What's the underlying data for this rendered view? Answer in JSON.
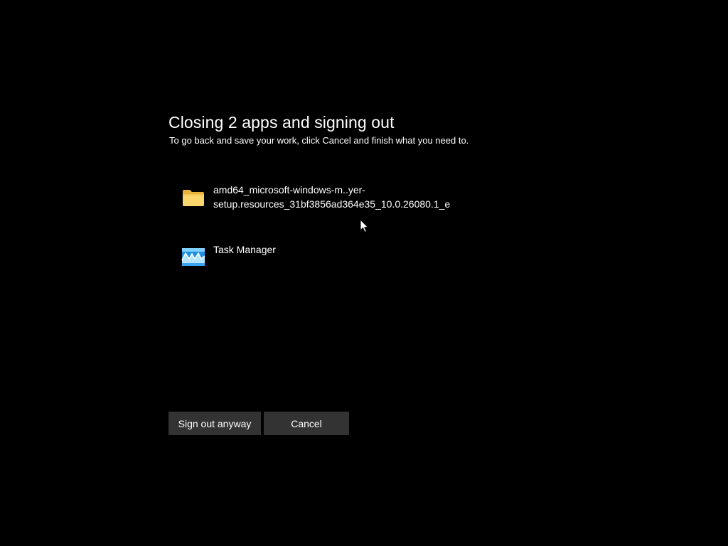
{
  "dialog": {
    "title": "Closing 2 apps and signing out",
    "subtitle": "To go back and save your work, click Cancel and finish what you need to."
  },
  "apps": [
    {
      "icon": "folder-icon",
      "name_line1": "amd64_microsoft-windows-m..yer-",
      "name_line2": "setup.resources_31bf3856ad364e35_10.0.26080.1_e"
    },
    {
      "icon": "task-manager-icon",
      "name_line1": "Task Manager",
      "name_line2": ""
    }
  ],
  "buttons": {
    "sign_out_label": "Sign out anyway",
    "cancel_label": "Cancel"
  },
  "colors": {
    "background": "#000000",
    "text": "#ffffff",
    "button_bg": "#333333"
  }
}
